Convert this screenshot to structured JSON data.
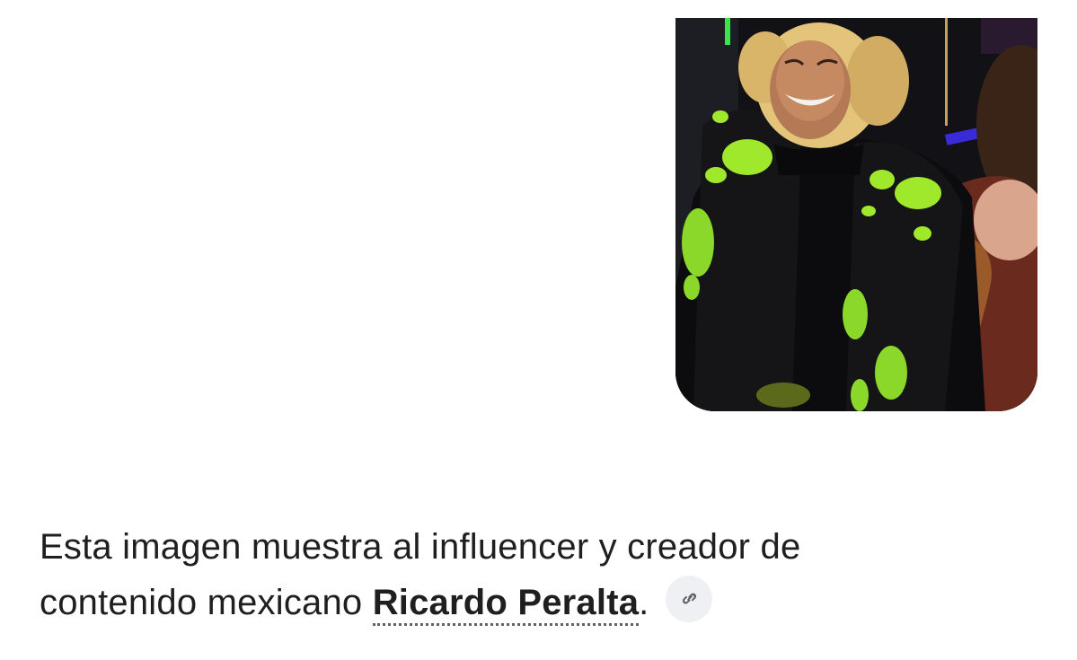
{
  "response": {
    "text_line1": "Esta imagen muestra al influencer y creador de",
    "text_line2_before": "contenido mexicano ",
    "entity_name": "Ricardo Peralta",
    "text_after": "."
  },
  "image": {
    "alt": "Persona riendo con chaqueta negra con manchas verde neón"
  },
  "icons": {
    "source_link": "link-icon"
  },
  "colors": {
    "background": "#ffffff",
    "text": "#1f1f1f",
    "chip_background": "#eef0f3",
    "jacket_accent": "#9fe82c"
  }
}
